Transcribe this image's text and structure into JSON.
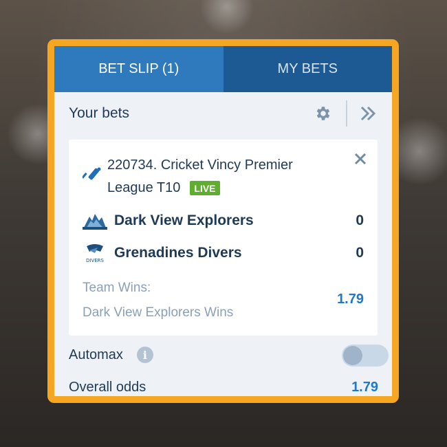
{
  "tabs": [
    {
      "label": "BET SLIP (1)",
      "active": true
    },
    {
      "label": "MY BETS",
      "active": false
    }
  ],
  "header": {
    "title": "Your bets"
  },
  "bet": {
    "event_line1": "220734. Cricket Vincy Premier",
    "event_line2": "League T10",
    "live_badge": "LIVE",
    "teams": [
      {
        "name": "Dark View Explorers",
        "score": "0",
        "logo": "dark-view-explorers-logo"
      },
      {
        "name": "Grenadines Divers",
        "score": "0",
        "logo": "grenadines-divers-logo"
      }
    ],
    "market": "Team Wins:",
    "selection": "Dark View Explorers Wins",
    "odds": "1.79"
  },
  "automax": {
    "label": "Automax",
    "enabled": false
  },
  "overall": {
    "label": "Overall odds",
    "value": "1.79"
  },
  "logo_text": {
    "divers": "DIVERS"
  },
  "colors": {
    "frame": "#f5a623",
    "tab_active": "#2f79bd",
    "tab_inactive": "#1d5a94",
    "odds": "#1e79c8",
    "live": "#5fae2e",
    "text_dark": "#1f3a55",
    "text_muted": "#8aa0b6"
  },
  "icons": {
    "settings": "gear-icon",
    "collapse": "double-chevron-right-icon",
    "remove": "close-icon",
    "sport": "cricket-bat-icon",
    "info": "info-icon"
  }
}
